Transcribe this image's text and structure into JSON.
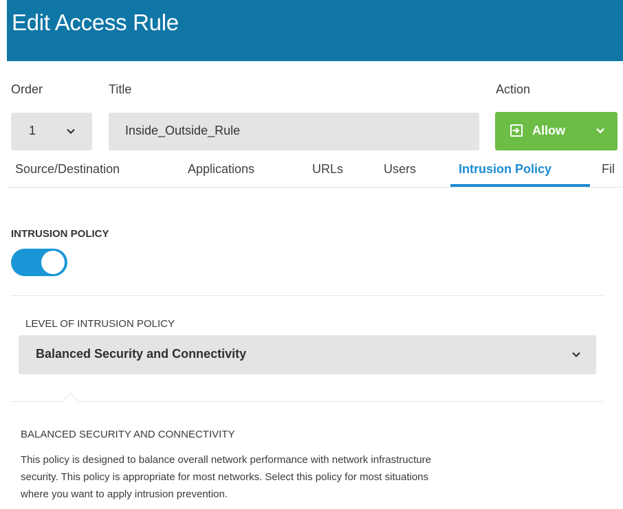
{
  "window": {
    "title": "Edit Access Rule"
  },
  "form": {
    "order_label": "Order",
    "order_value": "1",
    "title_label": "Title",
    "title_value": "Inside_Outside_Rule",
    "action_label": "Action",
    "action_value": "Allow",
    "action_icon": "enter-arrow-icon"
  },
  "tabs": [
    {
      "label": "Source/Destination",
      "active": false
    },
    {
      "label": "Applications",
      "active": false
    },
    {
      "label": "URLs",
      "active": false
    },
    {
      "label": "Users",
      "active": false
    },
    {
      "label": "Intrusion Policy",
      "active": true
    },
    {
      "label": "Fil",
      "active": false
    }
  ],
  "intrusion": {
    "section_title": "INTRUSION POLICY",
    "enabled": true,
    "level_label": "LEVEL OF INTRUSION POLICY",
    "level_value": "Balanced Security and Connectivity",
    "description_title": "BALANCED SECURITY AND CONNECTIVITY",
    "description_lines": [
      "This policy is designed to balance overall network performance with network infrastructure",
      "security. This policy is appropriate for most networks. Select this policy for most situations",
      "where you want to apply intrusion prevention."
    ]
  },
  "colors": {
    "header": "#0f76a6",
    "allow": "#6bbd45",
    "accent": "#1d8bd1",
    "toggle": "#1a96d6"
  }
}
